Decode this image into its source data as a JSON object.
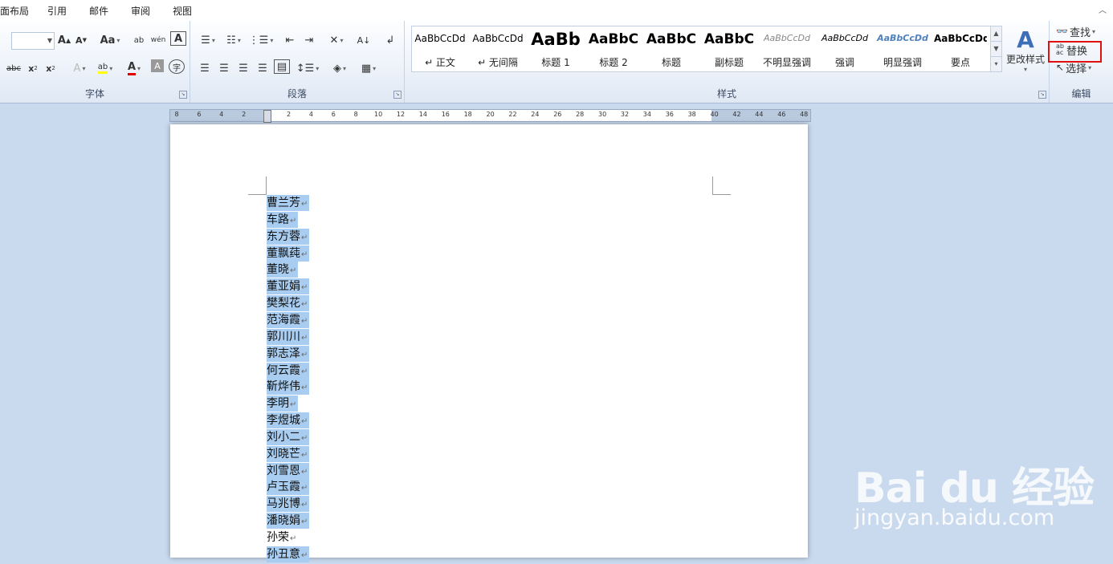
{
  "menu": {
    "tabs": [
      "页面布局",
      "引用",
      "邮件",
      "审阅",
      "视图"
    ],
    "collapse": "︿"
  },
  "ribbon": {
    "font_group": {
      "label": "字体",
      "launcher": "↘"
    },
    "paragraph_group": {
      "label": "段落",
      "launcher": "↘"
    },
    "styles_group": {
      "label": "样式",
      "launcher": "↘",
      "styles": [
        {
          "sample": "AaBbCcDd",
          "name": "↵ 正文"
        },
        {
          "sample": "AaBbCcDd",
          "name": "↵ 无间隔"
        },
        {
          "sample": "AaBb",
          "name": "标题 1"
        },
        {
          "sample": "AaBbC",
          "name": "标题 2"
        },
        {
          "sample": "AaBbC",
          "name": "标题"
        },
        {
          "sample": "AaBbC",
          "name": "副标题"
        },
        {
          "sample": "AaBbCcDd",
          "name": "不明显强调"
        },
        {
          "sample": "AaBbCcDd",
          "name": "强调"
        },
        {
          "sample": "AaBbCcDd",
          "name": "明显强调"
        },
        {
          "sample": "AaBbCcDd",
          "name": "要点"
        }
      ],
      "change_styles": "更改样式"
    },
    "editing_group": {
      "label": "编辑",
      "find": "查找",
      "replace": "替换",
      "select": "选择"
    },
    "highlight_color": "#e01010"
  },
  "ruler": {
    "numbers": [
      "8",
      "6",
      "4",
      "2",
      "2",
      "4",
      "6",
      "8",
      "10",
      "12",
      "14",
      "16",
      "18",
      "20",
      "22",
      "24",
      "26",
      "28",
      "30",
      "32",
      "34",
      "36",
      "38",
      "40",
      "42",
      "44",
      "46",
      "48"
    ]
  },
  "document": {
    "paragraph_mark": "↵",
    "selection_color": "#a8cdf0",
    "names": [
      {
        "text": "曹兰芳",
        "selected": true
      },
      {
        "text": "车路",
        "selected": true
      },
      {
        "text": "东方蓉",
        "selected": true
      },
      {
        "text": "董飘莼",
        "selected": true
      },
      {
        "text": "董晓",
        "selected": true
      },
      {
        "text": "董亚娟",
        "selected": true
      },
      {
        "text": "樊梨花",
        "selected": true
      },
      {
        "text": "范海霞",
        "selected": true
      },
      {
        "text": "郭川川",
        "selected": true
      },
      {
        "text": "郭志泽",
        "selected": true
      },
      {
        "text": "何云霞",
        "selected": true
      },
      {
        "text": "靳烨伟",
        "selected": true
      },
      {
        "text": "李明",
        "selected": true
      },
      {
        "text": "李煜城",
        "selected": true
      },
      {
        "text": "刘小二",
        "selected": true
      },
      {
        "text": "刘晓芒",
        "selected": true
      },
      {
        "text": "刘雪恩",
        "selected": true
      },
      {
        "text": "卢玉霞",
        "selected": true
      },
      {
        "text": "马兆博",
        "selected": true
      },
      {
        "text": "潘晓娟",
        "selected": true
      },
      {
        "text": "孙荣",
        "selected": false
      },
      {
        "text": "孙丑意",
        "selected": true
      }
    ]
  },
  "watermark": {
    "logo": "Bai du 经验",
    "url": "jingyan.baidu.com"
  }
}
